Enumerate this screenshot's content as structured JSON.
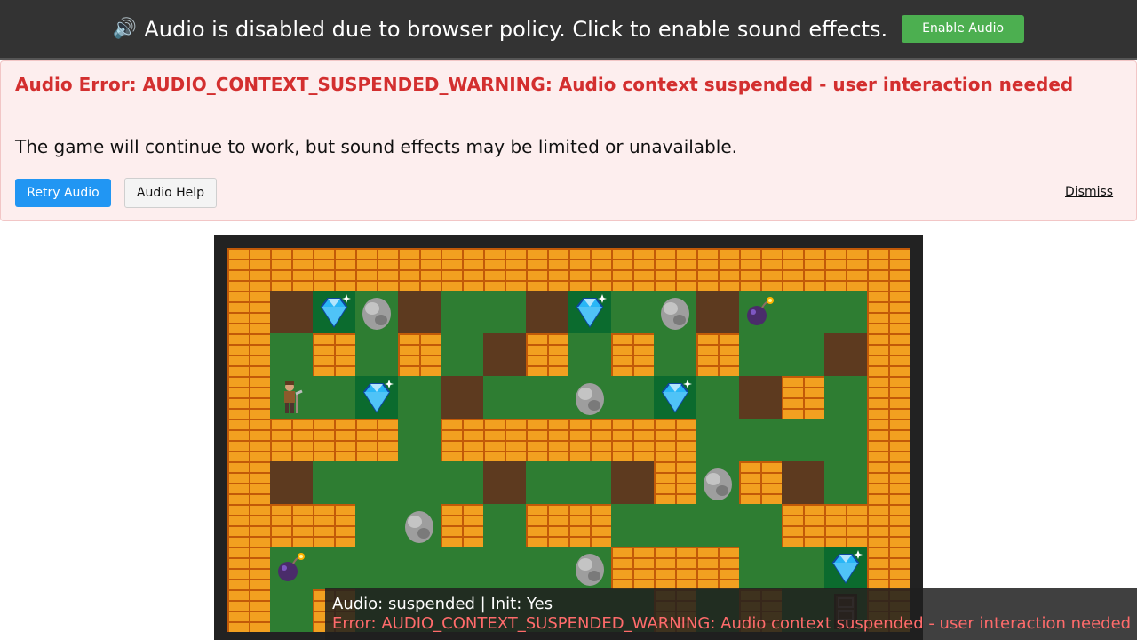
{
  "banner": {
    "speaker_icon": "speaker-icon",
    "message": "Audio is disabled due to browser policy. Click to enable sound effects.",
    "enable_label": "Enable Audio"
  },
  "error_panel": {
    "title": "Audio Error: AUDIO_CONTEXT_SUSPENDED_WARNING: Audio context suspended - user interaction needed",
    "subtitle": "The game will continue to work, but sound effects may be limited or unavailable.",
    "retry_label": "Retry Audio",
    "help_label": "Audio Help",
    "dismiss_label": "Dismiss",
    "accent_color": "#d32f2f"
  },
  "board": {
    "legend": {
      "W": "brick wall",
      "G": "grass",
      "D": "dirt",
      "S": "rock",
      "J": "diamond",
      "B": "bomb",
      "P": "player",
      "E": "exit door"
    },
    "rows": [
      "WWWWWWWWWWWWWWWW",
      "WDJSDGGDJGSDBGGW",
      "WGWGWGDWGWGWGGDW",
      "WPGJGDGGSGJGDWGW",
      "WWWWGWWWWWWGGGGW",
      "WDGGGGDGGDWSWDGW",
      "WWWGSWGWWGGGGWWW",
      "WBGGGGGGSWWWGGJW",
      "WGWGGGGGGGWGWGEW"
    ]
  },
  "status": {
    "line1": "Audio: suspended | Init: Yes",
    "line2": "Error: AUDIO_CONTEXT_SUSPENDED_WARNING: Audio context suspended - user interaction needed"
  }
}
